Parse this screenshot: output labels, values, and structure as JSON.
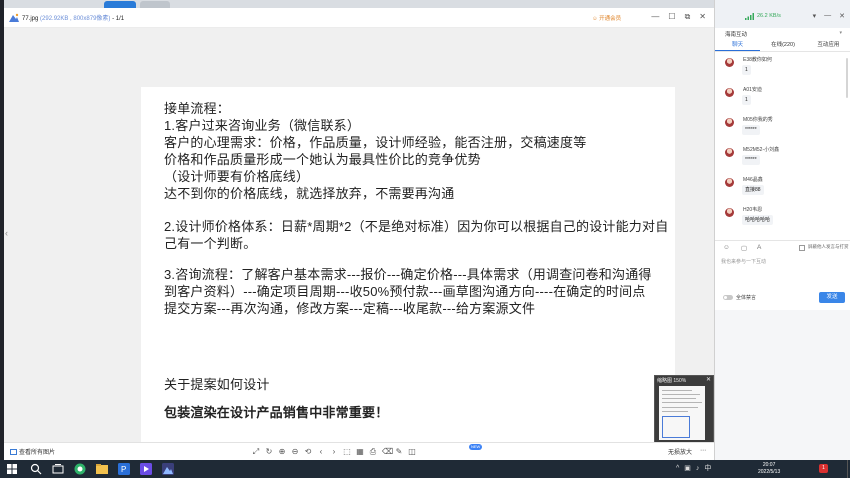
{
  "browser_tabs": [
    "",
    ""
  ],
  "viewer": {
    "file_name": "77.jpg",
    "file_meta": "(292.92KB , 800x879像素)",
    "page_indicator": "- 1/1",
    "vip_label": "开通会员",
    "minimize": "—",
    "maximize": "☐",
    "restore": "⧉",
    "close": "✕",
    "prev_arrow": "‹"
  },
  "document": {
    "lines": [
      "接单流程：",
      "1.客户过来咨询业务（微信联系）",
      "客户的心理需求：价格，作品质量，设计师经验，能否注册，交稿速度等",
      "价格和作品质量形成一个她认为最具性价比的竞争优势",
      "（设计师要有价格底线）",
      "达不到你的价格底线，就选择放弃，不需要再沟通",
      "2.设计师价格体系：日薪*周期*2（不是绝对标准）因为你可以根据自己的设计能力对自",
      "己有一个判断。",
      "3.咨询流程：了解客户基本需求---报价---确定价格---具体需求（用调查问卷和沟通得",
      "到客户资料）---确定项目周期---收50%预付款---画草图沟通方向----在确定的时间点",
      "提交方案---再次沟通，修改方案---定稿---收尾款---给方案源文件",
      "关于提案如何设计",
      "包装渲染在设计产品销售中非常重要！"
    ]
  },
  "thumbnail": {
    "label": "缩略图 150%",
    "close": "✕"
  },
  "toolbar": {
    "view_all": "查看所有图片",
    "tools": [
      "⤢",
      "↻",
      "⊕",
      "⊖",
      "⟲",
      "‹",
      "›",
      "⬚",
      "▦",
      "⎙",
      "⌫",
      "✎",
      "◫"
    ],
    "new_badge": "NEW",
    "lossless_zoom": "无损放大",
    "more": "⋯"
  },
  "chat": {
    "speed": "26.2 KB/s",
    "header_icons": [
      "▾",
      "—",
      "✕"
    ],
    "room_name": "海南互动",
    "room_caret": "▾",
    "tabs": [
      "聊天",
      "在线(220)",
      "互动应用"
    ],
    "messages": [
      {
        "name": "E38教你如何",
        "text": "1"
      },
      {
        "name": "A01安迪",
        "text": "1"
      },
      {
        "name": "M05你我的秀",
        "text": "******"
      },
      {
        "name": "M52M52-小刘鑫",
        "text": "******"
      },
      {
        "name": "M46晶鑫",
        "text": "直接88"
      },
      {
        "name": "H20韦恩",
        "text": "哈哈哈哈哈"
      }
    ],
    "compose_icons": [
      "☺",
      "▢",
      "A"
    ],
    "only_teacher_label": "屏蔽他人发言与打赏",
    "input_placeholder": "我也来参与一下互动",
    "mute_all": "全体禁言",
    "send": "发送"
  },
  "taskbar": {
    "tray": [
      "^",
      "▣",
      "♪",
      "中"
    ],
    "time": "20:07",
    "date": "2022/5/13",
    "notif_count": "1"
  }
}
